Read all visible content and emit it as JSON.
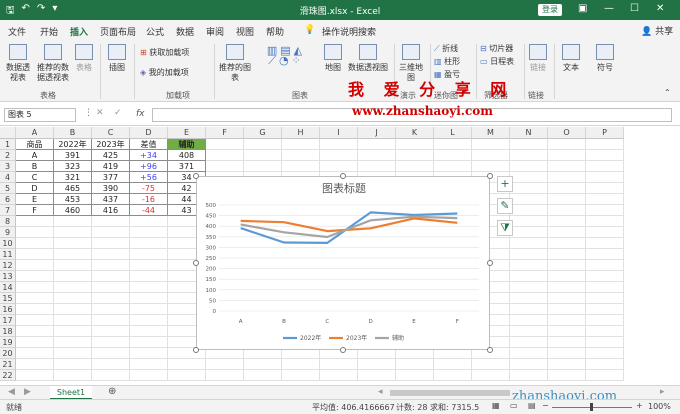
{
  "titlebar": {
    "title": "滑珠图.xlsx - Excel",
    "login": "登录",
    "qa_icons": [
      "save-icon",
      "undo-icon",
      "redo-icon",
      "customize-icon"
    ]
  },
  "tabs": [
    {
      "label": "文件"
    },
    {
      "label": "开始"
    },
    {
      "label": "插入",
      "active": true
    },
    {
      "label": "页面布局"
    },
    {
      "label": "公式"
    },
    {
      "label": "数据"
    },
    {
      "label": "审阅"
    },
    {
      "label": "视图"
    },
    {
      "label": "帮助"
    },
    {
      "label": "操作说明搜索"
    }
  ],
  "share": "共享",
  "ribbon": {
    "pivot": "数据透视表",
    "rec_pivot": "推荐的数据透视表",
    "table": "表格",
    "illustrations": "插图",
    "get_addins": "获取加载项",
    "my_addins": "我的加载项",
    "rec_charts": "推荐的图表",
    "map": "地图",
    "pivot_chart": "数据透视图",
    "3d_map": "三维地图",
    "line": "折线",
    "column": "柱形",
    "winloss": "盈亏",
    "slicer": "切片器",
    "timeline": "日程表",
    "link": "链接",
    "text": "文本",
    "symbol": "符号",
    "groups": {
      "table": "表格",
      "addins": "加载项",
      "charts": "图表",
      "tour": "演示",
      "spark": "迷你图",
      "filter": "筛选器",
      "links": "链接"
    }
  },
  "formula_bar": {
    "name_box": "图表 5",
    "fx": "fx",
    "value": ""
  },
  "columns": [
    "A",
    "B",
    "C",
    "D",
    "E",
    "F",
    "G",
    "H",
    "I",
    "J",
    "K",
    "L",
    "M",
    "N",
    "O",
    "P"
  ],
  "rows": [
    "1",
    "2",
    "3",
    "4",
    "5",
    "6",
    "7",
    "8",
    "9",
    "10",
    "11",
    "12",
    "13",
    "14",
    "15",
    "16",
    "17",
    "18",
    "19",
    "20",
    "21",
    "22"
  ],
  "table": {
    "headers": [
      "商品",
      "2022年",
      "2023年",
      "差值",
      "辅助"
    ],
    "rows": [
      [
        "A",
        "391",
        "425",
        "+34",
        "408"
      ],
      [
        "B",
        "323",
        "419",
        "+96",
        "371"
      ],
      [
        "C",
        "321",
        "377",
        "+56",
        "34"
      ],
      [
        "D",
        "465",
        "390",
        "-75",
        "42"
      ],
      [
        "E",
        "453",
        "437",
        "-16",
        "44"
      ],
      [
        "F",
        "460",
        "416",
        "-44",
        "43"
      ]
    ]
  },
  "colors": {
    "excel_green": "#217346",
    "header_fill": "#70ad47",
    "positive": "#4040ff",
    "negative": "#e03030",
    "series_2022": "#5b9bd5",
    "series_2023": "#ed7d31",
    "series_aux": "#a5a5a5"
  },
  "chart_data": {
    "type": "line",
    "title": "图表标题",
    "categories": [
      "A",
      "B",
      "C",
      "D",
      "E",
      "F"
    ],
    "series": [
      {
        "name": "2022年",
        "values": [
          391,
          323,
          321,
          465,
          453,
          460
        ],
        "color": "#5b9bd5"
      },
      {
        "name": "2023年",
        "values": [
          425,
          419,
          377,
          390,
          437,
          416
        ],
        "color": "#ed7d31"
      },
      {
        "name": "辅助",
        "values": [
          408,
          371,
          349,
          428,
          445,
          438
        ],
        "color": "#a5a5a5"
      }
    ],
    "yticks": [
      "500",
      "450",
      "400",
      "350",
      "300",
      "250",
      "200",
      "150",
      "100",
      "50",
      "0"
    ],
    "ylim": [
      0,
      500
    ],
    "grid": true,
    "legend": "bottom"
  },
  "sheet_tab": "Sheet1",
  "status": {
    "ready": "就绪",
    "average": "平均值: 406.4166667",
    "count": "计数: 28",
    "sum": "求和: 7315.5",
    "zoom": "100%"
  },
  "watermark": {
    "cn": "我 爱 分 享 网",
    "url": "www.zhanshaoyi.com",
    "url2": "zhanshaoyi.com"
  }
}
